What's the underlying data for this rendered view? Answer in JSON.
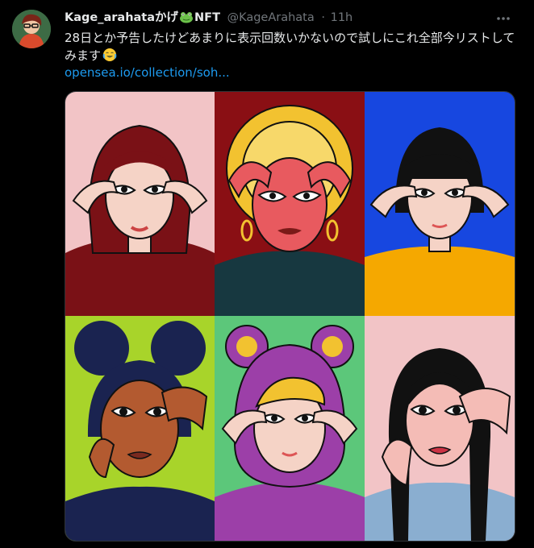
{
  "author": {
    "display_name": "Kage_arahataかげ",
    "name_suffix": "NFT",
    "handle": "@KageArahata",
    "separator": "·",
    "time": "11h"
  },
  "tweet": {
    "text": "28日とか予告したけどあまりに表示回数いかないので試しにこれ全部今リストしてみます",
    "link": "opensea.io/collection/soh..."
  },
  "icons": {
    "avatar": "avatar-illustration",
    "frog": "frog-emoji",
    "emoji": "face-with-tears-of-joy-emoji",
    "more": "more-icon"
  },
  "colors": {
    "background": "#000000",
    "text": "#e7e9ea",
    "muted": "#71767b",
    "link": "#1d9bf0"
  }
}
